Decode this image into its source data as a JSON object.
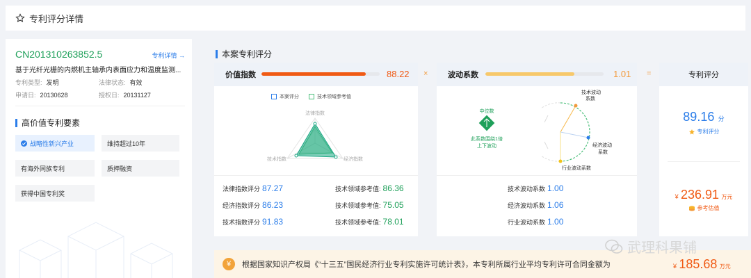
{
  "header": {
    "title": "专利评分详情",
    "icon": "star-icon"
  },
  "patent": {
    "number": "CN201310263852.5",
    "detail_link": "专利详情 →",
    "title": "基于光纤光栅的内燃机主轴承内表面应力和温度监测...",
    "type_label": "专利类型:",
    "type_value": "发明",
    "legal_label": "法律状态:",
    "legal_value": "有效",
    "apply_label": "申请日:",
    "apply_value": "20130628",
    "grant_label": "授权日:",
    "grant_value": "20131127"
  },
  "elements": {
    "title": "高价值专利要素",
    "tags": [
      {
        "label": "战略性新兴产业",
        "active": true
      },
      {
        "label": "维持超过10年",
        "active": false
      },
      {
        "label": "有海外同族专利",
        "active": false
      },
      {
        "label": "质押融资",
        "active": false
      },
      {
        "label": "获得中国专利奖",
        "active": false
      }
    ]
  },
  "section_title": "本案专利评分",
  "value_index": {
    "label": "价值指数",
    "value": "88.22",
    "progress": 0.8822,
    "legend_case": "本案评分",
    "legend_ref": "技术领域参考值",
    "radar_legal": "法律指数",
    "radar_tech": "技术指数",
    "radar_econ": "经济指数",
    "rows": [
      {
        "label": "法律指数评分",
        "value": "87.27",
        "ref_label": "技术领域参考值:",
        "ref_value": "86.36"
      },
      {
        "label": "经济指数评分",
        "value": "86.23",
        "ref_label": "技术领域参考值:",
        "ref_value": "75.05"
      },
      {
        "label": "技术指数评分",
        "value": "91.83",
        "ref_label": "技术领域参考值:",
        "ref_value": "78.01"
      }
    ]
  },
  "operators": {
    "times": "×",
    "equals": "="
  },
  "volatility": {
    "label": "波动系数",
    "value": "1.01",
    "progress": 0.75,
    "median": "中位数",
    "median_note_1": "此系数围绕1倍",
    "median_note_2": "上下波动",
    "gauge_tech_1": "技术波动",
    "gauge_tech_2": "系数",
    "gauge_econ_1": "经济波动",
    "gauge_econ_2": "系数",
    "gauge_industry": "行业波动系数",
    "rows": [
      {
        "label": "技术波动系数",
        "value": "1.00"
      },
      {
        "label": "经济波动系数",
        "value": "1.06"
      },
      {
        "label": "行业波动系数",
        "value": "1.00"
      }
    ]
  },
  "total": {
    "label": "专利评分",
    "score": "89.16",
    "score_unit": "分",
    "score_caption": "专利评分",
    "price_prefix": "¥",
    "price": "236.91",
    "price_unit": "万元",
    "price_caption": "参考估值"
  },
  "bottom": {
    "text": "根据国家知识产权局《“十三五”国民经济行业专利实施许可统计表》，本专利所属行业平均专利许可合同金额为",
    "prefix": "¥",
    "amount": "185.68",
    "unit": "万元",
    "icon": "yen-icon"
  },
  "watermark": {
    "text": "武理科果铺",
    "icon": "wechat-icon"
  },
  "colors": {
    "accent_blue": "#2b7de9",
    "green": "#1fa05a",
    "orange": "#f05a14",
    "yellow": "#f7c86a"
  }
}
